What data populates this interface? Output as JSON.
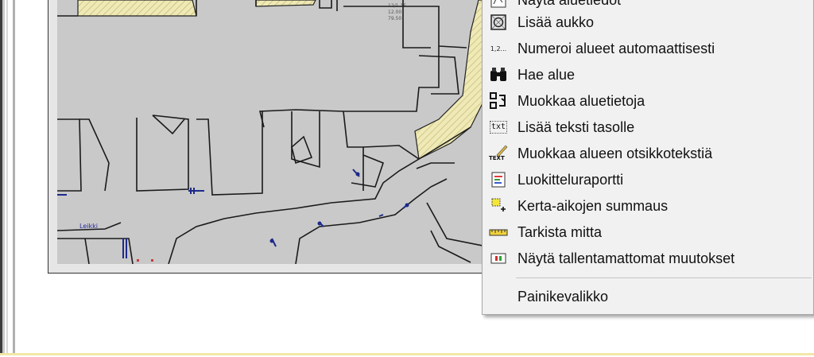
{
  "menu": {
    "items": [
      {
        "label": "Näytä aluetiedot",
        "icon": "area-info-icon"
      },
      {
        "label": "Lisää aukko",
        "icon": "add-hole-icon"
      },
      {
        "label": "Numeroi alueet automaattisesti",
        "icon": "auto-number-icon",
        "icon_text": "1,2..."
      },
      {
        "label": "Hae alue",
        "icon": "binoculars-icon"
      },
      {
        "label": "Muokkaa aluetietoja",
        "icon": "edit-area-data-icon"
      },
      {
        "label": "Lisää teksti tasolle",
        "icon": "add-text-icon",
        "icon_text": "txt"
      },
      {
        "label": "Muokkaa alueen otsikkotekstiä",
        "icon": "edit-title-text-icon",
        "icon_text": "TEXT"
      },
      {
        "label": "Luokitteluraportti",
        "icon": "classification-report-icon"
      },
      {
        "label": "Kerta-aikojen summaus",
        "icon": "time-sum-icon"
      },
      {
        "label": "Tarkista mitta",
        "icon": "measure-icon"
      },
      {
        "label": "Näytä tallentamattomat muutokset",
        "icon": "unsaved-changes-icon"
      }
    ],
    "footer_item": {
      "label": "Painikevalikko"
    }
  },
  "map": {
    "labels": {
      "street_label": "Leikki",
      "small_label_1": "12/1 15",
      "small_label_2": "12.00",
      "small_label_3": "79.50"
    },
    "colors": {
      "background": "#c9c9c9",
      "hatch": "#e8e2a8",
      "line": "#1a1a1a",
      "blue": "#1c2a8a"
    }
  }
}
